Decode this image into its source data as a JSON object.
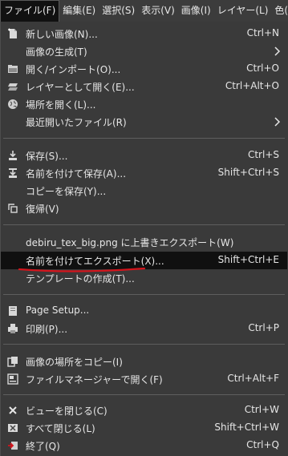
{
  "menubar": {
    "items": [
      {
        "label": "ファイル(F)"
      },
      {
        "label": "編集(E)"
      },
      {
        "label": "選択(S)"
      },
      {
        "label": "表示(V)"
      },
      {
        "label": "画像(I)"
      },
      {
        "label": "レイヤー(L)"
      },
      {
        "label": "色(C)"
      }
    ]
  },
  "menu": {
    "items": [
      {
        "label": "新しい画像(N)...",
        "accel": "Ctrl+N",
        "icon": "new-image-icon"
      },
      {
        "label": "画像の生成(T)",
        "icon": "none",
        "submenu": true
      },
      {
        "label": "開く/インポート(O)...",
        "accel": "Ctrl+O",
        "icon": "open-icon"
      },
      {
        "label": "レイヤーとして開く(E)...",
        "accel": "Ctrl+Alt+O",
        "icon": "open-as-layers-icon"
      },
      {
        "label": "場所を開く(L)...",
        "icon": "globe-icon"
      },
      {
        "label": "最近開いたファイル(R)",
        "icon": "none",
        "submenu": true
      },
      {
        "label": "保存(S)...",
        "accel": "Ctrl+S",
        "icon": "save-icon"
      },
      {
        "label": "名前を付けて保存(A)...",
        "accel": "Shift+Ctrl+S",
        "icon": "save-as-icon"
      },
      {
        "label": "コピーを保存(Y)...",
        "icon": "none"
      },
      {
        "label": "復帰(V)",
        "icon": "revert-icon"
      },
      {
        "label": "debiru_tex_big.png に上書きエクスポート(W)",
        "icon": "none"
      },
      {
        "label": "名前を付けてエクスポート(X)...",
        "accel": "Shift+Ctrl+E",
        "icon": "none"
      },
      {
        "label": "テンプレートの作成(T)...",
        "icon": "none"
      },
      {
        "label": "Page Setup...",
        "icon": "page-setup-icon"
      },
      {
        "label": "印刷(P)...",
        "accel": "Ctrl+P",
        "icon": "print-icon"
      },
      {
        "label": "画像の場所をコピー(I)",
        "icon": "copy-location-icon"
      },
      {
        "label": "ファイルマネージャーで開く(F)",
        "accel": "Ctrl+Alt+F",
        "icon": "file-manager-icon"
      },
      {
        "label": "ビューを閉じる(C)",
        "accel": "Ctrl+W",
        "icon": "close-icon"
      },
      {
        "label": "すべて閉じる(L)",
        "accel": "Shift+Ctrl+W",
        "icon": "close-all-icon"
      },
      {
        "label": "終了(Q)",
        "accel": "Ctrl+Q",
        "icon": "quit-icon"
      }
    ]
  },
  "colors": {
    "menu_bg": "#3a3a3a",
    "highlight_bg": "#101010",
    "text": "#e6e6e6",
    "annotation": "#d4141c"
  }
}
